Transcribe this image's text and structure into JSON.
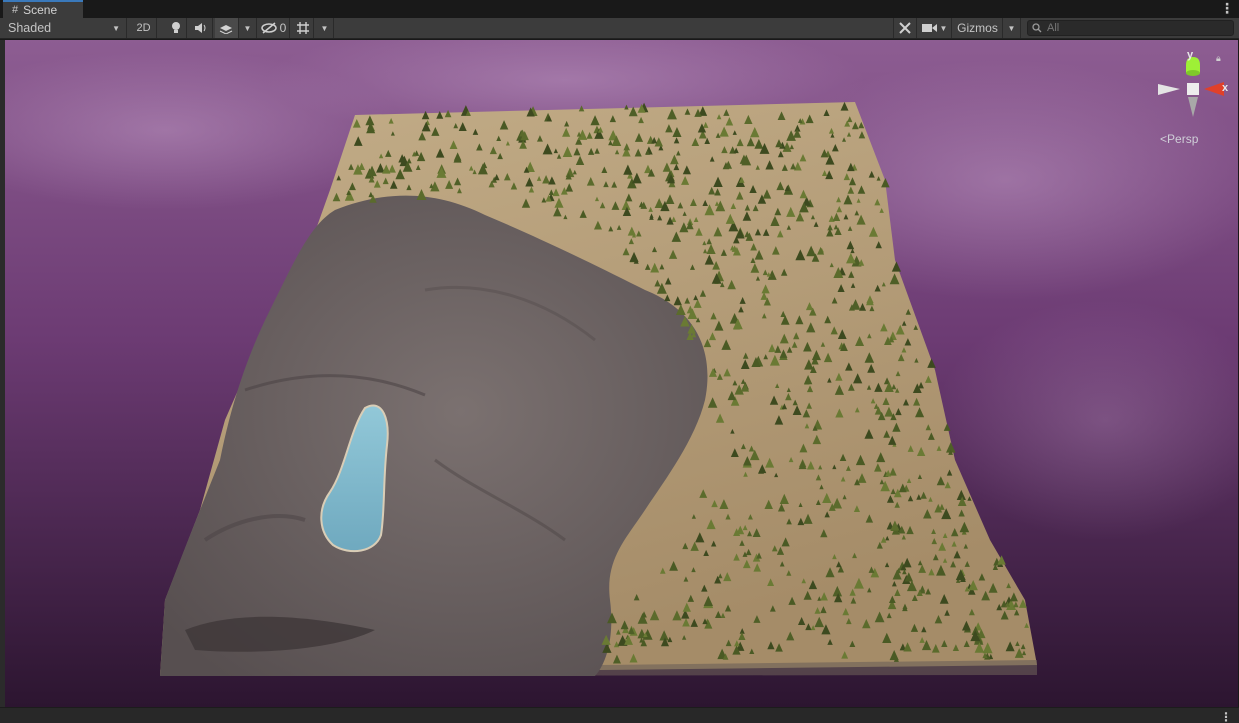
{
  "window": {
    "tab_label": "Scene",
    "tab_icon": "grid-icon"
  },
  "toolbar": {
    "draw_mode": "Shaded",
    "mode_2d": "2D",
    "hidden_count": "0",
    "gizmos_label": "Gizmos",
    "search_placeholder": "All"
  },
  "gizmo": {
    "y_label": "y",
    "x_label": "x",
    "projection": "Persp",
    "axis_colors": {
      "y": "#9ef036",
      "x": "#e0402a",
      "neutral": "#d8d8d8"
    }
  },
  "colors": {
    "tab_accent": "#3a79bb",
    "sky_top": "#8a5a8f",
    "sky_bottom": "#2e1632",
    "rock": "#706664",
    "sand": "#b39b78",
    "water": "#7fb9cd",
    "trees": "#4a5a24"
  },
  "icons": [
    "grid-icon",
    "kebab-menu-icon",
    "lightbulb-icon",
    "audio-icon",
    "effects-icon",
    "visibility-icon",
    "grid-snap-icon",
    "tools-icon",
    "camera-icon",
    "search-icon",
    "lock-icon"
  ]
}
